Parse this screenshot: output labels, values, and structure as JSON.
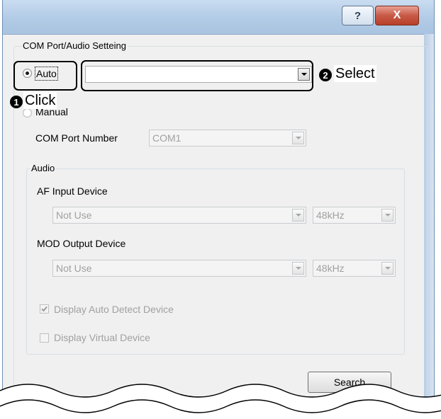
{
  "window": {
    "help_button": "?",
    "close_button": "X"
  },
  "com_group": {
    "legend": "COM Port/Audio Setteing",
    "auto_label": "Auto",
    "auto_selected": true,
    "auto_combo_value": "",
    "manual_label": "Manual",
    "com_port_label": "COM Port Number",
    "com_port_value": "COM1"
  },
  "audio_group": {
    "legend": "Audio",
    "af_input_label": "AF Input Device",
    "af_input_value": "Not Use",
    "af_rate_value": "48kHz",
    "mod_output_label": "MOD Output Device",
    "mod_output_value": "Not Use",
    "mod_rate_value": "48kHz",
    "display_auto_detect_label": "Display Auto Detect Device",
    "display_auto_detect_checked": true,
    "display_virtual_label": "Display Virtual Device",
    "display_virtual_checked": false
  },
  "search_button": "Search",
  "annotations": {
    "step1_number": "1",
    "step1_text": "Click",
    "step2_number": "2",
    "step2_text": "Select"
  }
}
